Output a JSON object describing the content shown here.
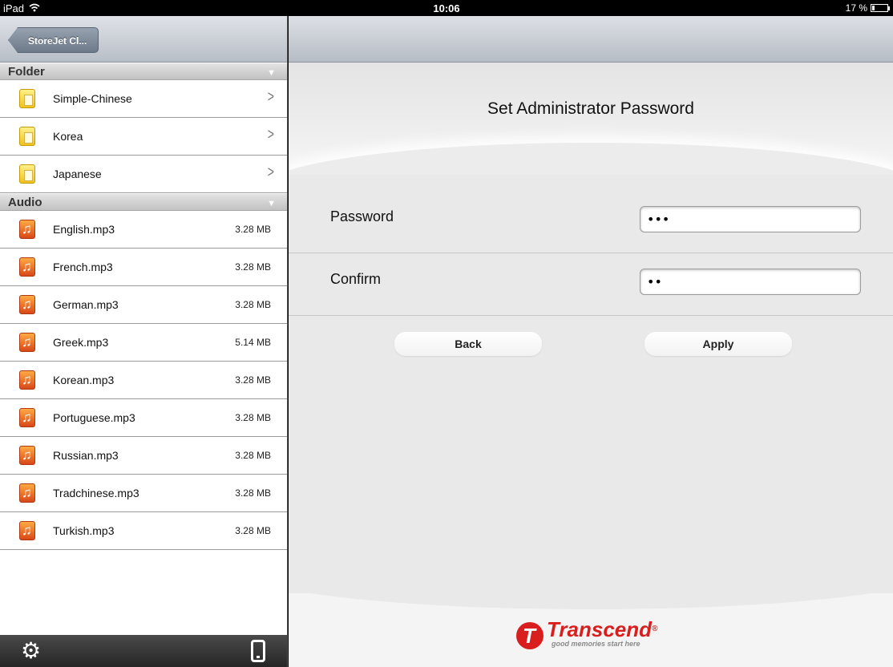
{
  "status_bar": {
    "device": "iPad",
    "time": "10:06",
    "battery_text": "17 %",
    "battery_level": 0.17
  },
  "left_panel": {
    "back_label": "StoreJet Cl...",
    "sections": [
      {
        "title": "Folder",
        "items": [
          {
            "label": "Simple-Chinese",
            "type": "folder"
          },
          {
            "label": "Korea",
            "type": "folder"
          },
          {
            "label": "Japanese",
            "type": "folder"
          }
        ]
      },
      {
        "title": "Audio",
        "items": [
          {
            "label": "English.mp3",
            "size": "3.28 MB",
            "type": "audio"
          },
          {
            "label": "French.mp3",
            "size": "3.28 MB",
            "type": "audio"
          },
          {
            "label": "German.mp3",
            "size": "3.28 MB",
            "type": "audio"
          },
          {
            "label": "Greek.mp3",
            "size": "5.14 MB",
            "type": "audio"
          },
          {
            "label": "Korean.mp3",
            "size": "3.28 MB",
            "type": "audio"
          },
          {
            "label": "Portuguese.mp3",
            "size": "3.28 MB",
            "type": "audio"
          },
          {
            "label": "Russian.mp3",
            "size": "3.28 MB",
            "type": "audio"
          },
          {
            "label": "Tradchinese.mp3",
            "size": "3.28 MB",
            "type": "audio"
          },
          {
            "label": "Turkish.mp3",
            "size": "3.28 MB",
            "type": "audio"
          }
        ]
      }
    ],
    "toolbar": {
      "left_icon": "gear-icon",
      "right_icon": "device-icon"
    }
  },
  "main": {
    "title": "Set Administrator Password",
    "password_label": "Password",
    "password_value": "•••",
    "confirm_label": "Confirm",
    "confirm_value": "••",
    "back_label": "Back",
    "apply_label": "Apply"
  },
  "brand": {
    "name": "Transcend",
    "reg": "®",
    "tagline": "good memories start here",
    "color": "#d91e1e"
  }
}
